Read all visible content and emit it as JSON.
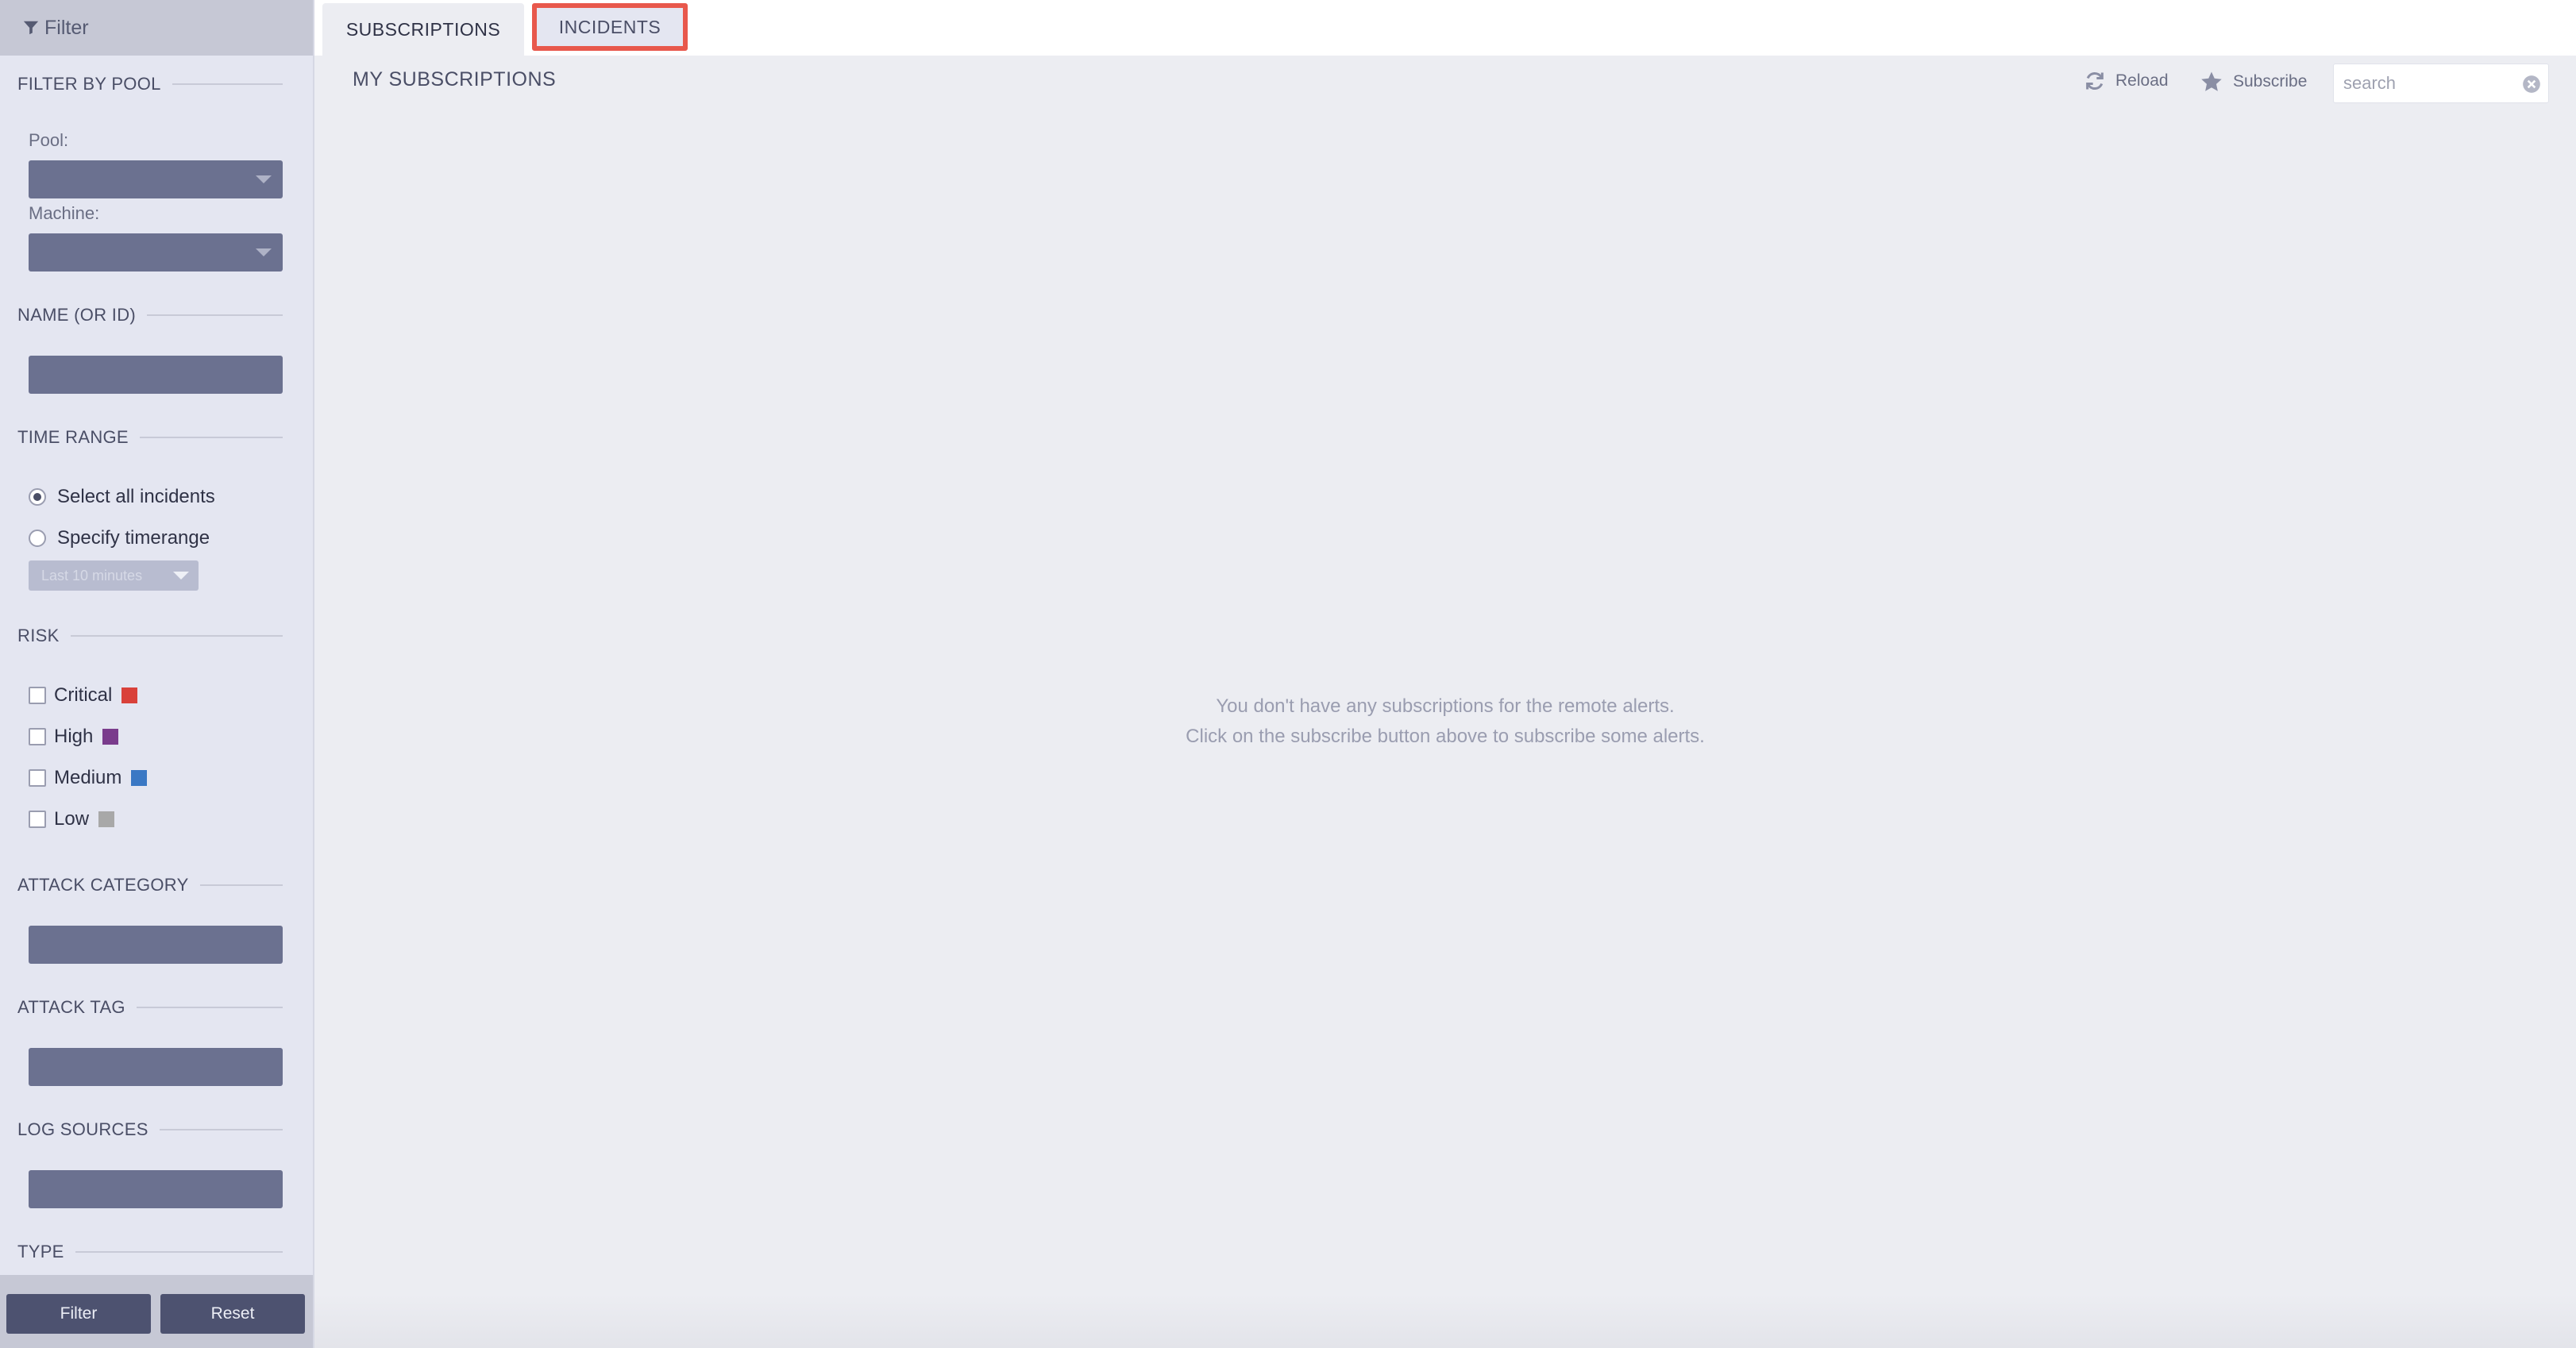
{
  "sidebar": {
    "header": {
      "label": "Filter",
      "icon": "funnel-icon"
    },
    "sections": {
      "pool": {
        "title": "FILTER BY POOL",
        "pool_label": "Pool:",
        "machine_label": "Machine:"
      },
      "name": {
        "title": "NAME (OR ID)"
      },
      "time_range": {
        "title": "TIME RANGE",
        "option_all": "Select all incidents",
        "option_specify": "Specify timerange",
        "selected": "all",
        "range_value": "Last 10 minutes"
      },
      "risk": {
        "title": "RISK",
        "items": [
          {
            "label": "Critical",
            "color": "#d9413a"
          },
          {
            "label": "High",
            "color": "#7a3c8c"
          },
          {
            "label": "Medium",
            "color": "#3a78c4"
          },
          {
            "label": "Low",
            "color": "#a8a8a8"
          }
        ]
      },
      "attack_category": {
        "title": "ATTACK CATEGORY"
      },
      "attack_tag": {
        "title": "ATTACK TAG"
      },
      "log_sources": {
        "title": "LOG SOURCES"
      },
      "type": {
        "title": "TYPE"
      }
    },
    "buttons": {
      "filter": "Filter",
      "reset": "Reset"
    }
  },
  "tabs": [
    {
      "label": "SUBSCRIPTIONS",
      "active": true
    },
    {
      "label": "INCIDENTS",
      "active": false,
      "highlighted": true,
      "highlight_color": "#e8584c"
    }
  ],
  "main": {
    "title": "MY SUBSCRIPTIONS",
    "toolbar": {
      "reload_label": "Reload",
      "subscribe_label": "Subscribe",
      "search_placeholder": "search"
    },
    "empty_message": {
      "line1": "You don't have any subscriptions for the remote alerts.",
      "line2": "Click on the subscribe button above to subscribe some alerts."
    }
  }
}
